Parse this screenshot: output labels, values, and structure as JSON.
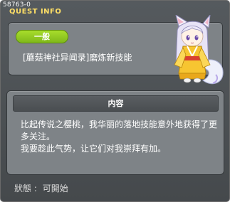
{
  "window": {
    "quest_id": "58763-0",
    "title": "QUEST INFO"
  },
  "summary": {
    "category": "一般",
    "quest_name": "[蘑菇神社异闻录]磨炼新技能"
  },
  "details": {
    "header": "内容",
    "description_lines": [
      "比起传说之樱桃，我华丽的落地技能意外地获得了更多关注。",
      "我要趁此气势，让它们对我崇拜有加。"
    ]
  },
  "status": {
    "label": "狀態 :",
    "value": "可開始"
  },
  "colors": {
    "title": "#ffe066",
    "badge": "#8cc41f",
    "panel": "#7e8387",
    "frame": "#4b4f52"
  },
  "icons": {
    "npc_portrait": "fox-girl-npc-icon"
  }
}
